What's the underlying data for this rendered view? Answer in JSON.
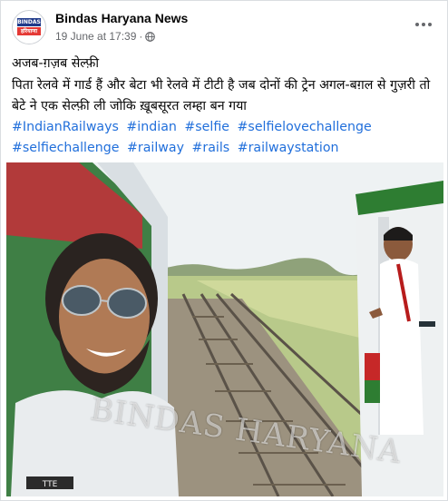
{
  "post": {
    "page_name": "Bindas Haryana News",
    "timestamp": "19 June at 17:39",
    "separator": "·",
    "avatar": {
      "line1": "BINDAS",
      "line2": "हरियाणा"
    },
    "title": "अजब-ग़ज़ब सेल्फ़ी",
    "body": "पिता रेलवे में गार्ड हैं और बेटा भी रेलवे में टीटी है जब दोनों की ट्रेन अगल-बग़ल से गुज़री तो बेटे ने एक सेल्फ़ी ली जोकि ख़ूबसूरत लम्हा बन गया",
    "hashtags": [
      "#IndianRailways",
      "#indian",
      "#selfie",
      "#selfielovechallenge",
      "#selfiechallenge",
      "#railway",
      "#rails",
      "#railwaystation"
    ],
    "photo_watermark": "BINDAS HARYANA",
    "badge_text": "TTE"
  },
  "icons": {
    "privacy": "globe-icon",
    "menu": "more-options-icon"
  },
  "colors": {
    "hashtag": "#216fdb",
    "meta": "#65676b",
    "train_green": "#2e7d32",
    "train_red": "#c62828"
  }
}
